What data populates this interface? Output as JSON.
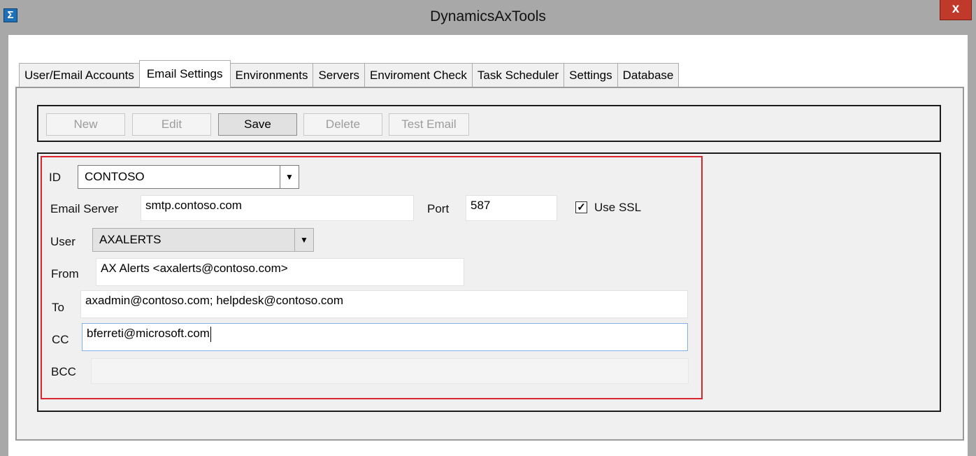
{
  "window": {
    "title": "DynamicsAxTools",
    "close_label": "x",
    "app_icon_glyph": "Σ"
  },
  "tabs": [
    {
      "label": "User/Email Accounts",
      "active": false
    },
    {
      "label": "Email Settings",
      "active": true
    },
    {
      "label": "Environments",
      "active": false
    },
    {
      "label": "Servers",
      "active": false
    },
    {
      "label": "Enviroment Check",
      "active": false
    },
    {
      "label": "Task Scheduler",
      "active": false
    },
    {
      "label": "Settings",
      "active": false
    },
    {
      "label": "Database",
      "active": false
    }
  ],
  "toolbar": {
    "new_label": "New",
    "edit_label": "Edit",
    "save_label": "Save",
    "delete_label": "Delete",
    "test_email_label": "Test Email"
  },
  "form": {
    "id": {
      "label": "ID",
      "value": "CONTOSO"
    },
    "email_server": {
      "label": "Email Server",
      "value": "smtp.contoso.com"
    },
    "port": {
      "label": "Port",
      "value": "587"
    },
    "use_ssl": {
      "label": "Use SSL",
      "checked": true,
      "check_glyph": "✓"
    },
    "user": {
      "label": "User",
      "value": "AXALERTS"
    },
    "from": {
      "label": "From",
      "value": "AX Alerts <axalerts@contoso.com>"
    },
    "to": {
      "label": "To",
      "value": "axadmin@contoso.com; helpdesk@contoso.com"
    },
    "cc": {
      "label": "CC",
      "value": "bferreti@microsoft.com"
    },
    "bcc": {
      "label": "BCC",
      "value": ""
    }
  },
  "colors": {
    "highlight_border": "#d9252f",
    "close_button": "#c0392b",
    "titlebar": "#a8a8a8"
  }
}
